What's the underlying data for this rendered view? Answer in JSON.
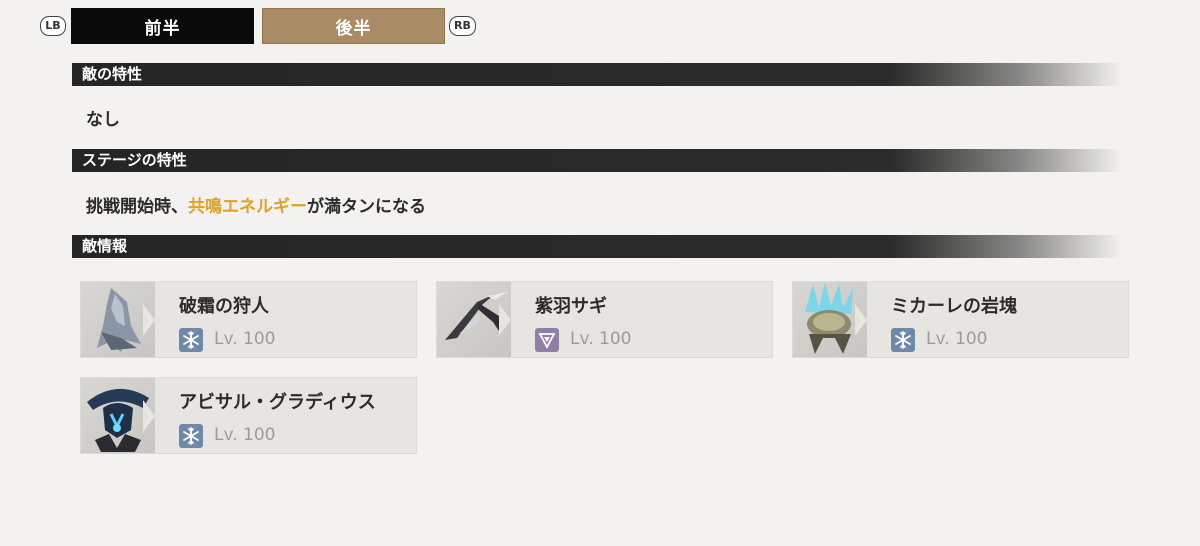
{
  "tabs": {
    "lb_hint": "LB",
    "rb_hint": "RB",
    "first_half": "前半",
    "second_half": "後半"
  },
  "sections": {
    "enemy_traits": {
      "title": "敵の特性",
      "text": "なし"
    },
    "stage_traits": {
      "title": "ステージの特性",
      "text_prefix": "挑戦開始時、",
      "text_highlight": "共鳴エネルギー",
      "text_suffix": "が満タンになる"
    },
    "enemy_info": {
      "title": "敵情報"
    }
  },
  "enemies": [
    {
      "name": "破霜の狩人",
      "element": "glacio",
      "element_icon": "snowflake-icon",
      "level": "Lv. 100"
    },
    {
      "name": "紫羽サギ",
      "element": "havoc",
      "element_icon": "havoc-icon",
      "level": "Lv. 100"
    },
    {
      "name": "ミカーレの岩塊",
      "element": "glacio",
      "element_icon": "snowflake-icon",
      "level": "Lv. 100"
    },
    {
      "name": "アビサル・グラディウス",
      "element": "glacio",
      "element_icon": "snowflake-icon",
      "level": "Lv. 100"
    }
  ],
  "colors": {
    "accent_highlight": "#e0a125",
    "tab_active": "#0a0a0a",
    "tab_inactive": "#a98b66",
    "glacio": "#6f8aa8",
    "havoc": "#8e7fa6"
  }
}
